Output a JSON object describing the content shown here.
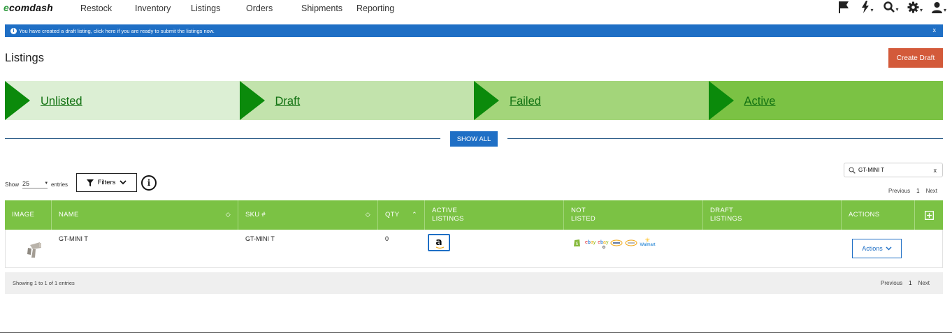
{
  "brand": {
    "prefix": "e",
    "rest": "comdash"
  },
  "nav": {
    "items": [
      "Restock",
      "Inventory",
      "Listings",
      "Orders",
      "Shipments",
      "Reporting"
    ]
  },
  "top_icons": [
    "flag-icon",
    "lightning-icon",
    "search-icon",
    "gear-icon",
    "user-icon"
  ],
  "alert": {
    "text": "You have created a draft listing, click here if you are ready to submit the listings now.",
    "close": "x"
  },
  "page": {
    "title": "Listings",
    "create_label": "Create Draft"
  },
  "steps": [
    "Unlisted",
    "Draft",
    "Failed",
    "Active"
  ],
  "show_all": "SHOW ALL",
  "search": {
    "value": "GT-MINI T",
    "clear": "x"
  },
  "pager": {
    "prev": "Previous",
    "page": "1",
    "next": "Next"
  },
  "entries": {
    "show": "Show",
    "value": "25",
    "suffix": "entries"
  },
  "filters_label": "Filters",
  "table": {
    "headers": {
      "image": "IMAGE",
      "name": "NAME",
      "sku": "SKU #",
      "qty": "QTY",
      "active": "ACTIVE LISTINGS",
      "not_listed": "NOT LISTED",
      "draft": "DRAFT LISTINGS",
      "actions": "ACTIONS"
    },
    "rows": [
      {
        "name": "GT-MINI T",
        "sku": "GT-MINI T",
        "qty": "0",
        "active_channel": "a",
        "not_listed": [
          "ebay",
          "ebay",
          "walmart"
        ],
        "actions_label": "Actions"
      }
    ]
  },
  "footer": {
    "showing": "Showing 1 to 1 of 1 entries"
  },
  "colors": {
    "accent_blue": "#1f6fc5",
    "green_header": "#7bc244",
    "create_btn": "#d35a3a",
    "step_arrow": "#0b8a0b"
  }
}
